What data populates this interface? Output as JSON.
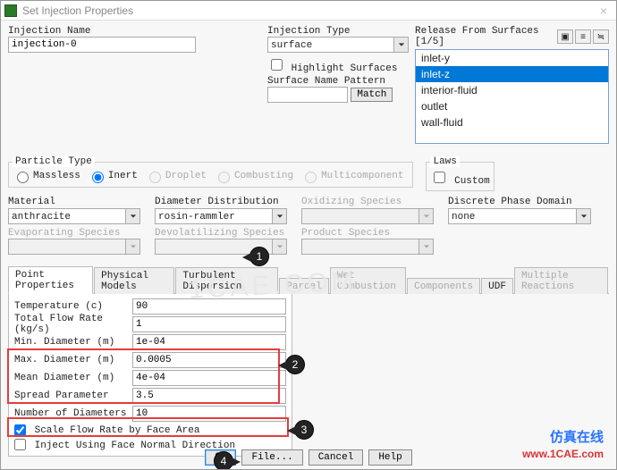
{
  "window": {
    "title": "Set Injection Properties"
  },
  "injection": {
    "name_label": "Injection Name",
    "name_value": "injection-0",
    "type_label": "Injection Type",
    "type_value": "surface",
    "highlight_label": "Highlight Surfaces",
    "pattern_label": "Surface Name Pattern",
    "pattern_value": "",
    "match_label": "Match"
  },
  "release": {
    "label": "Release From Surfaces [1/5]",
    "items": [
      "inlet-y",
      "inlet-z",
      "interior-fluid",
      "outlet",
      "wall-fluid"
    ],
    "selected_index": 1
  },
  "particle": {
    "legend": "Particle Type",
    "massless": "Massless",
    "inert": "Inert",
    "droplet": "Droplet",
    "combusting": "Combusting",
    "multicomponent": "Multicomponent"
  },
  "laws": {
    "legend": "Laws",
    "custom": "Custom"
  },
  "sections": {
    "material_label": "Material",
    "material_value": "anthracite",
    "diameter_dist_label": "Diameter Distribution",
    "diameter_dist_value": "rosin-rammler",
    "oxidizing_label": "Oxidizing Species",
    "oxidizing_value": "",
    "dpd_label": "Discrete Phase Domain",
    "dpd_value": "none",
    "evaporating_label": "Evaporating Species",
    "devolatilizing_label": "Devolatilizing Species",
    "product_label": "Product Species"
  },
  "tabs": {
    "point": "Point Properties",
    "physical": "Physical Models",
    "turb": "Turbulent Dispersion",
    "parcel": "Parcel",
    "wet": "Wet Combustion",
    "components": "Components",
    "udf": "UDF",
    "multiple": "Multiple Reactions"
  },
  "point_props": {
    "temperature_label": "Temperature (c)",
    "temperature": "90",
    "total_flow_label": "Total Flow Rate (kg/s)",
    "total_flow": "1",
    "min_d_label": "Min. Diameter (m)",
    "min_d": "1e-04",
    "max_d_label": "Max. Diameter (m)",
    "max_d": "0.0005",
    "mean_d_label": "Mean Diameter (m)",
    "mean_d": "4e-04",
    "spread_label": "Spread Parameter",
    "spread": "3.5",
    "num_d_label": "Number of Diameters",
    "num_d": "10",
    "scale_label": "Scale Flow Rate by Face Area",
    "inject_normal_label": "Inject Using Face Normal Direction"
  },
  "buttons": {
    "ok": "OK",
    "file": "File...",
    "cancel": "Cancel",
    "help": "Help"
  },
  "markers": {
    "m1": "1",
    "m2": "2",
    "m3": "3",
    "m4": "4"
  },
  "branding": {
    "cn": "仿真在线",
    "url": "www.1CAE.com",
    "bkg": "1CAE.COM"
  }
}
